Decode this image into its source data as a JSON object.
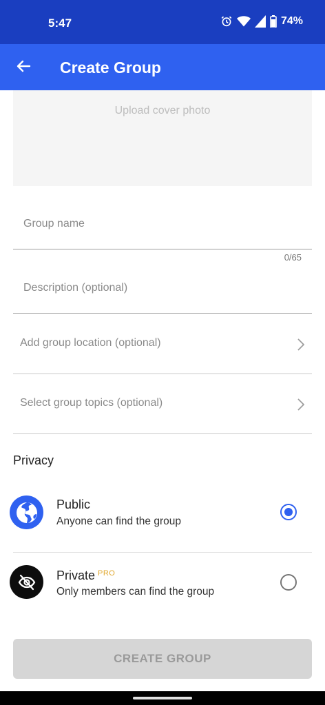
{
  "status_bar": {
    "time": "5:47",
    "battery": "74%"
  },
  "app_bar": {
    "title": "Create Group"
  },
  "cover": {
    "label": "Upload cover photo"
  },
  "form": {
    "group_name_placeholder": "Group name",
    "group_name_value": "",
    "group_name_counter": "0/65",
    "description_placeholder": "Description (optional)",
    "description_value": "",
    "location_label": "Add group location (optional)",
    "topics_label": "Select group topics (optional)"
  },
  "privacy": {
    "heading": "Privacy",
    "options": [
      {
        "title": "Public",
        "subtitle": "Anyone can find the group",
        "icon": "globe-icon",
        "selected": true
      },
      {
        "title": "Private",
        "badge": "PRO",
        "subtitle": "Only members can find the group",
        "icon": "eye-off-icon",
        "selected": false
      }
    ]
  },
  "actions": {
    "create_label": "CREATE GROUP"
  },
  "colors": {
    "status_bar": "#1a3ec0",
    "app_bar": "#2f61f0",
    "accent": "#2f61f0",
    "pro_badge": "#e0a62a",
    "button_disabled": "#d6d6d6"
  }
}
